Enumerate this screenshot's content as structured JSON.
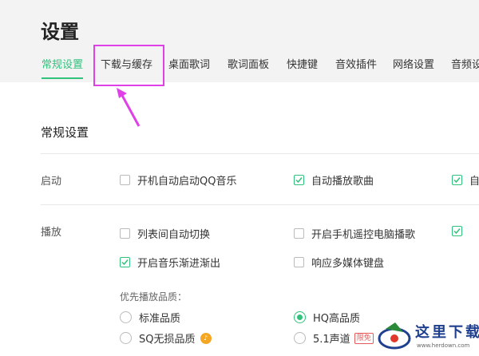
{
  "page": {
    "title": "设置"
  },
  "tabs": [
    {
      "label": "常规设置",
      "active": true
    },
    {
      "label": "下载与缓存",
      "active": false
    },
    {
      "label": "桌面歌词",
      "active": false
    },
    {
      "label": "歌词面板",
      "active": false
    },
    {
      "label": "快捷键",
      "active": false
    },
    {
      "label": "音效插件",
      "active": false
    },
    {
      "label": "网络设置",
      "active": false
    },
    {
      "label": "音频设",
      "active": false
    }
  ],
  "section": {
    "title": "常规设置"
  },
  "startup": {
    "label": "启动",
    "options": [
      {
        "label": "开机自动启动QQ音乐",
        "checked": false
      },
      {
        "label": "自动播放歌曲",
        "checked": true
      },
      {
        "label": "自",
        "checked": true
      }
    ]
  },
  "playback": {
    "label": "播放",
    "options": [
      {
        "label": "列表间自动切换",
        "checked": false
      },
      {
        "label": "开启手机遥控电脑播歌",
        "checked": false
      },
      {
        "label": "",
        "checked": true
      },
      {
        "label": "开启音乐渐进渐出",
        "checked": true
      },
      {
        "label": "响应多媒体键盘",
        "checked": false
      }
    ]
  },
  "quality": {
    "label": "优先播放品质：",
    "options": [
      {
        "label": "标准品质",
        "selected": false
      },
      {
        "label": "HQ高品质",
        "selected": true
      },
      {
        "label": "SQ无损品质",
        "selected": false,
        "badge_icon": "vip-coin-icon"
      },
      {
        "label": "5.1声道",
        "selected": false,
        "badge": "限免"
      }
    ]
  },
  "watermark": {
    "text": "这里下载",
    "url": "www.herdown.com"
  },
  "colors": {
    "accent": "#31c27c",
    "highlight": "#e040e8",
    "header_bg": "#f3f3f3"
  }
}
